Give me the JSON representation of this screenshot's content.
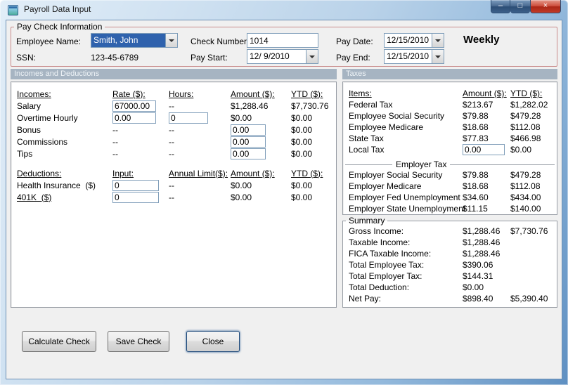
{
  "window": {
    "title": "Payroll Data Input",
    "controls": {
      "minimize": "–",
      "maximize": "□",
      "close": "×"
    }
  },
  "paycheck": {
    "group_title": "Pay Check Information",
    "employee_name": {
      "label": "Employee Name:",
      "value": "Smith, John"
    },
    "ssn": {
      "label": "SSN:",
      "value": "123-45-6789"
    },
    "check_number": {
      "label": "Check Number:",
      "value": "1014"
    },
    "pay_start": {
      "label": "Pay Start:",
      "value": "12/ 9/2010"
    },
    "pay_date": {
      "label": "Pay Date:",
      "value": "12/15/2010"
    },
    "pay_end": {
      "label": "Pay End:",
      "value": "12/15/2010"
    },
    "frequency": "Weekly"
  },
  "incomes_deductions": {
    "header": "Incomes and Deductions",
    "incomes_headers": {
      "item": "Incomes:",
      "rate": "Rate ($):",
      "hours": "Hours:",
      "amount": "Amount ($):",
      "ytd": "YTD ($):"
    },
    "incomes_rows": [
      {
        "label": "Salary",
        "rate": "67000.00",
        "hours": "--",
        "amount": "$1,288.46",
        "ytd": "$7,730.76"
      },
      {
        "label": "Overtime Hourly",
        "rate": "0.00",
        "hours": "0",
        "amount": "$0.00",
        "ytd": "$0.00"
      },
      {
        "label": "Bonus",
        "rate": "--",
        "hours": "--",
        "amount": "0.00",
        "ytd": "$0.00"
      },
      {
        "label": "Commissions",
        "rate": "--",
        "hours": "--",
        "amount": "0.00",
        "ytd": "$0.00"
      },
      {
        "label": "Tips",
        "rate": "--",
        "hours": "--",
        "amount": "0.00",
        "ytd": "$0.00"
      }
    ],
    "deductions_headers": {
      "item": "Deductions:",
      "input": "Input:",
      "annual_limit": "Annual Limit($):",
      "amount": "Amount ($):",
      "ytd": "YTD ($):"
    },
    "deductions_rows": [
      {
        "label": "Health Insurance  ($)",
        "input": "0",
        "annual_limit": "--",
        "amount": "$0.00",
        "ytd": "$0.00"
      },
      {
        "label": "401K  ($)",
        "input": "0",
        "annual_limit": "--",
        "amount": "$0.00",
        "ytd": "$0.00"
      }
    ]
  },
  "taxes": {
    "header": "Taxes",
    "headers": {
      "item": "Items:",
      "amount": "Amount ($):",
      "ytd": "YTD ($):"
    },
    "employee_rows": [
      {
        "label": "Federal Tax",
        "amount": "$213.67",
        "ytd": "$1,282.02"
      },
      {
        "label": "Employee Social Security",
        "amount": "$79.88",
        "ytd": "$479.28"
      },
      {
        "label": "Employee Medicare",
        "amount": "$18.68",
        "ytd": "$112.08"
      },
      {
        "label": "State Tax",
        "amount": "$77.83",
        "ytd": "$466.98"
      },
      {
        "label": "Local Tax",
        "amount": "0.00",
        "ytd": "$0.00"
      }
    ],
    "employer_divider": "Employer Tax",
    "employer_rows": [
      {
        "label": "Employer Social Security",
        "amount": "$79.88",
        "ytd": "$479.28"
      },
      {
        "label": "Employer Medicare",
        "amount": "$18.68",
        "ytd": "$112.08"
      },
      {
        "label": "Employer Fed Unemployment",
        "amount": "$34.60",
        "ytd": "$434.00"
      },
      {
        "label": "Employer State Unemployment",
        "amount": "$11.15",
        "ytd": "$140.00"
      }
    ]
  },
  "summary": {
    "title": "Summary",
    "rows": [
      {
        "label": "Gross Income:",
        "amount": "$1,288.46",
        "ytd": "$7,730.76"
      },
      {
        "label": "Taxable Income:",
        "amount": "$1,288.46",
        "ytd": ""
      },
      {
        "label": "FICA Taxable Income:",
        "amount": "$1,288.46",
        "ytd": ""
      },
      {
        "label": "Total Employee Tax:",
        "amount": "$390.06",
        "ytd": ""
      },
      {
        "label": "Total Employer Tax:",
        "amount": "$144.31",
        "ytd": ""
      },
      {
        "label": "Total Deduction:",
        "amount": "$0.00",
        "ytd": ""
      },
      {
        "label": "Net Pay:",
        "amount": "$898.40",
        "ytd": "$5,390.40"
      }
    ]
  },
  "buttons": {
    "calculate": "Calculate Check",
    "save": "Save Check",
    "close": "Close"
  },
  "colors": {
    "section_header_bg": "#a6b4c2",
    "group_border": "#c98c8c",
    "selection": "#2f62ad",
    "close_button": "#c23b28"
  }
}
